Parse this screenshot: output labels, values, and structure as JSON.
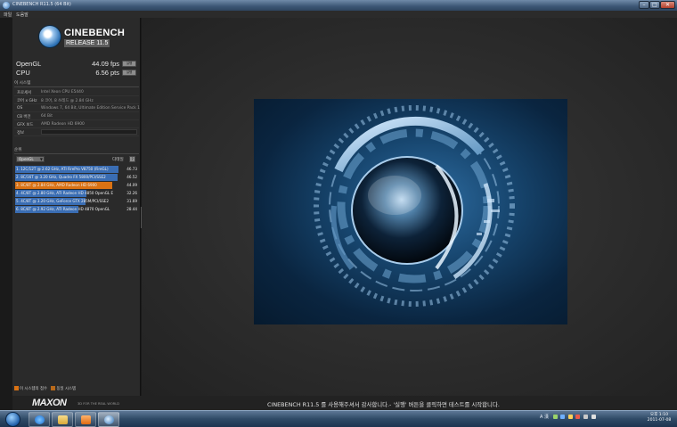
{
  "window": {
    "title": "CINEBENCH R11.5 (64 Bit)",
    "minimize": "–",
    "maximize": "□",
    "close": "✕"
  },
  "menu": {
    "items": [
      "파일",
      "도움말"
    ]
  },
  "logo": {
    "name": "CINEBENCH",
    "release": "RELEASE 11.5"
  },
  "scores": {
    "run_label": "실행",
    "items": [
      {
        "label": "OpenGL",
        "value": "44.09 fps"
      },
      {
        "label": "CPU",
        "value": "6.56 pts"
      }
    ]
  },
  "system": {
    "header": "이 시스템",
    "rows": [
      {
        "label": "프로세서",
        "value": "Intel Xeon CPU E5440"
      },
      {
        "label": "코어 x GHz",
        "value": "8 코어, 8 쓰레드 @ 2.84 GHz"
      },
      {
        "label": "OS",
        "value": "Windows 7, 64 Bit, Ultimate Edition Service Pack 1"
      },
      {
        "label": "CB 버전",
        "value": "64 Bit"
      },
      {
        "label": "GFX 보드",
        "value": "AMD Radeon HD 6900"
      },
      {
        "label": "정보",
        "value": ""
      }
    ]
  },
  "ranking": {
    "header": "순위",
    "dropdown": "OpenGL",
    "details_label": "디테일",
    "details_button": "?",
    "rows": [
      {
        "text": "1. 12C/12T @ 2.62 GHz, ATI FirePro V8750 (FireGL)",
        "score": "46.73",
        "bar": 1.0,
        "color": "#3a6db3"
      },
      {
        "text": "2. 8C/16T @ 3.20 GHz, Quadro FX 5800/PCI/SSE2",
        "score": "46.52",
        "bar": 0.995,
        "color": "#3a6db3"
      },
      {
        "text": "3. 8C/8T @ 2.84 GHz, AMD Radeon HD 6900",
        "score": "44.09",
        "bar": 0.943,
        "color": "#d97214"
      },
      {
        "text": "4. 4C/8T @ 2.80 GHz, ATI Radeon HD 4850 OpenGL E",
        "score": "32.26",
        "bar": 0.69,
        "color": "#3a6db3"
      },
      {
        "text": "5. 4C/8T @ 3.20 GHz, GeForce GTX 285M/PCI/SSE2",
        "score": "31.69",
        "bar": 0.678,
        "color": "#3a6db3"
      },
      {
        "text": "6. 8C/8T @ 2.92 GHz, ATI Radeon HD 4870 OpenGL",
        "score": "28.44",
        "bar": 0.608,
        "color": "#3a6db3"
      }
    ]
  },
  "legend": {
    "this_system": "이 시스템의 점수",
    "same_system": "동일 시스템",
    "this_color": "#d97214",
    "same_color": "#b8691a"
  },
  "footer": {
    "brand": "MAXON",
    "tagline": "3D FOR THE REAL WORLD",
    "status": "CINEBENCH R11.5 를 사용해주셔서 감사합니다.- '실행' 버튼을 클릭하면 테스트를 시작합니다."
  },
  "taskbar": {
    "apps": [
      "internet-explorer",
      "file-explorer",
      "media-player",
      "cinebench"
    ],
    "tray_lang": "A 漢",
    "clock_time": "오후 1:10",
    "clock_date": "2011-07-08"
  }
}
